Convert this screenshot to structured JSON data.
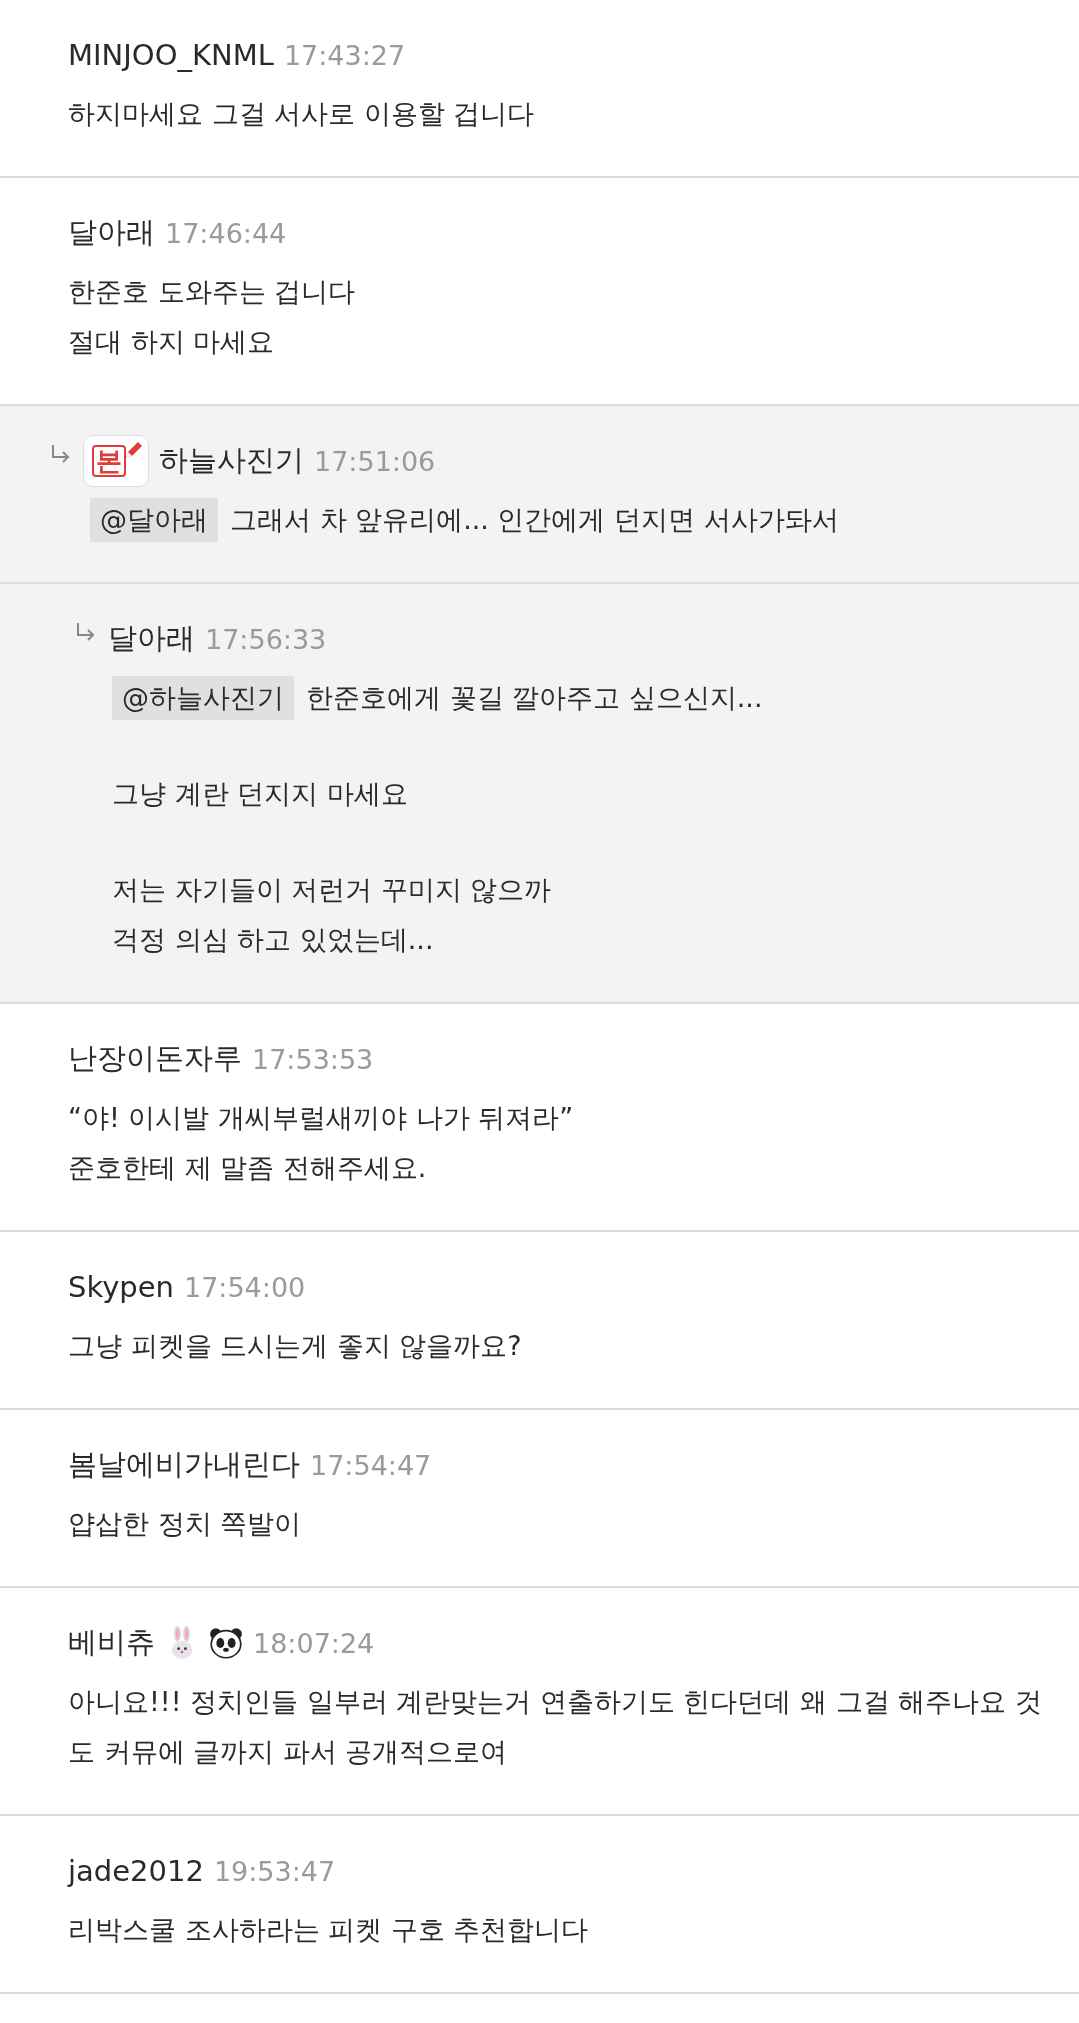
{
  "comments": [
    {
      "author": "MINJOO_KNML",
      "time": "17:43:27",
      "paragraphs": [
        [
          "하지마세요 그걸 서사로 이용할 겁니다"
        ]
      ]
    },
    {
      "author": "달아래",
      "time": "17:46:44",
      "paragraphs": [
        [
          "한준호 도와주는 겁니다",
          "절대 하지 마세요"
        ]
      ],
      "replies": [
        {
          "author": "하늘사진기",
          "time": "17:51:06",
          "avatar": {
            "kind": "badge",
            "label": "본"
          },
          "mention": "@달아래",
          "paragraphs": [
            [
              "그래서 차 앞유리에... 인간에게 던지면 서사가돠서"
            ]
          ],
          "replies": [
            {
              "author": "달아래",
              "time": "17:56:33",
              "mention": "@하늘사진기",
              "paragraphs": [
                [
                  "한준호에게 꽃길 깔아주고 싶으신지..."
                ],
                [
                  "그냥 계란 던지지 마세요"
                ],
                [
                  "저는 자기들이 저런거 꾸미지 않으까",
                  "걱정 의심 하고 있었는데..."
                ]
              ]
            }
          ]
        }
      ]
    },
    {
      "author": "난장이돈자루",
      "time": "17:53:53",
      "paragraphs": [
        [
          "“야! 이시발 개씨부럴새끼야 나가 뒤져라”",
          "준호한테 제 말좀 전해주세요."
        ]
      ]
    },
    {
      "author": "Skypen",
      "time": "17:54:00",
      "paragraphs": [
        [
          "그냥 피켓을 드시는게 좋지 않을까요?"
        ]
      ]
    },
    {
      "author": "봄날에비가내린다",
      "time": "17:54:47",
      "paragraphs": [
        [
          "얍삽한 정치 쪽발이"
        ]
      ]
    },
    {
      "author": "베비츄",
      "time": "18:07:24",
      "name_emoji": [
        {
          "kind": "rabbit"
        },
        {
          "kind": "panda"
        }
      ],
      "paragraphs": [
        [
          "아니요!!! 정치인들 일부러 계란맞는거 연출하기도 힌다던데 왜 그걸 해주나요 것",
          "도 커뮤에 글까지 파서 공개적으로여"
        ]
      ]
    },
    {
      "author": "jade2012",
      "time": "19:53:47",
      "paragraphs": [
        [
          "리박스쿨 조사하라는 피켓 구호 추천합니다"
        ]
      ]
    }
  ]
}
